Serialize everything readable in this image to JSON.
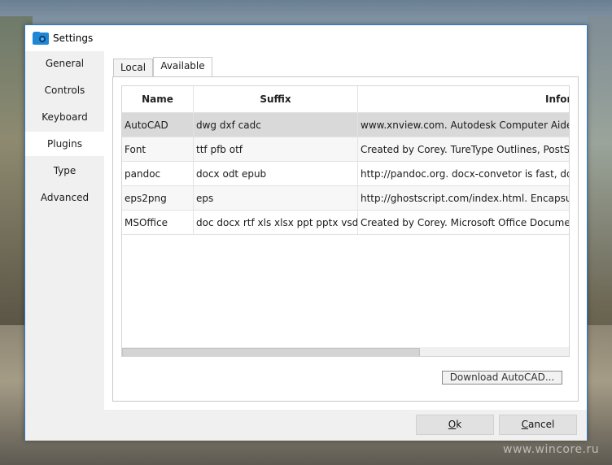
{
  "window": {
    "title": "Settings"
  },
  "sidebar": {
    "items": [
      {
        "label": "General"
      },
      {
        "label": "Controls"
      },
      {
        "label": "Keyboard"
      },
      {
        "label": "Plugins",
        "active": true
      },
      {
        "label": "Type"
      },
      {
        "label": "Advanced"
      }
    ]
  },
  "tabs": [
    {
      "label": "Local"
    },
    {
      "label": "Available",
      "active": true
    }
  ],
  "table": {
    "headers": {
      "name": "Name",
      "suffix": "Suffix",
      "info": "Infor"
    },
    "rows": [
      {
        "name": "AutoCAD",
        "suffix": "dwg dxf cadc",
        "info": "www.xnview.com. Autodesk Computer Aided De"
      },
      {
        "name": "Font",
        "suffix": "ttf pfb otf",
        "info": "Created by Corey. TureType Outlines, PostScript C"
      },
      {
        "name": "pandoc",
        "suffix": "docx odt epub",
        "info": "http://pandoc.org. docx-convetor is fast, does't n"
      },
      {
        "name": "eps2png",
        "suffix": "eps",
        "info": "http://ghostscript.com/index.html. Encapsulated"
      },
      {
        "name": "MSOffice",
        "suffix": "doc docx rtf xls xlsx ppt pptx vsd vsdx",
        "info": "Created by Corey. Microsoft Office Document (Re"
      }
    ],
    "selected_row": 0
  },
  "download_button": {
    "label": "Download AutoCAD..."
  },
  "footer": {
    "ok": {
      "mnemonic": "O",
      "rest": "k"
    },
    "cancel": {
      "mnemonic": "C",
      "rest": "ancel"
    }
  },
  "watermark": "www.wincore.ru",
  "colors": {
    "accent_border": "#2b79c6",
    "icon_blue": "#1e88d6",
    "selected_row": "#d9d9d9"
  }
}
